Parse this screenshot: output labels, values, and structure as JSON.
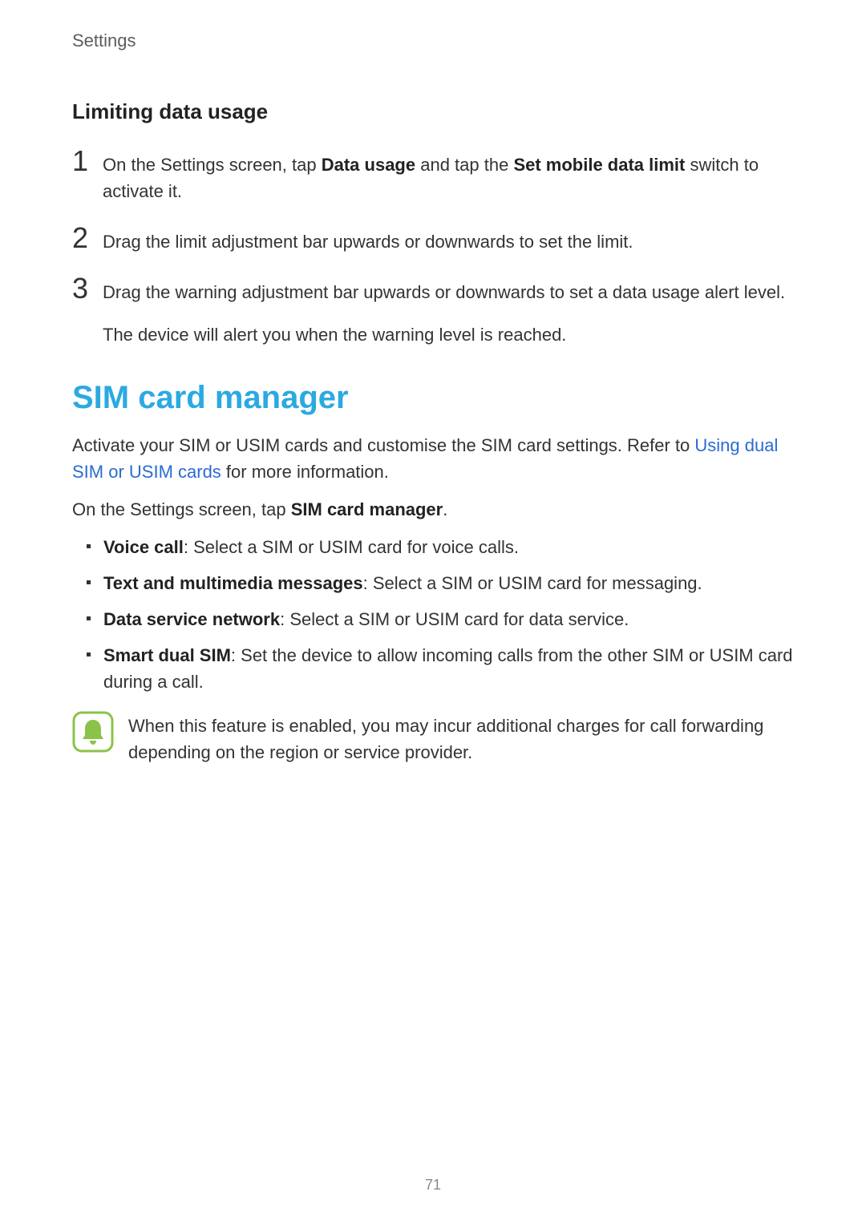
{
  "header": {
    "title": "Settings"
  },
  "subsection": {
    "title": "Limiting data usage"
  },
  "steps": {
    "s1": {
      "num": "1",
      "pre": "On the Settings screen, tap ",
      "bold1": "Data usage",
      "mid": " and tap the ",
      "bold2": "Set mobile data limit",
      "post": " switch to activate it."
    },
    "s2": {
      "num": "2",
      "text": "Drag the limit adjustment bar upwards or downwards to set the limit."
    },
    "s3": {
      "num": "3",
      "line1": "Drag the warning adjustment bar upwards or downwards to set a data usage alert level.",
      "line2": "The device will alert you when the warning level is reached."
    }
  },
  "section": {
    "title": "SIM card manager",
    "intro_pre": "Activate your SIM or USIM cards and customise the SIM card settings. Refer to ",
    "intro_link": "Using dual SIM or USIM cards",
    "intro_post": " for more information.",
    "instruction_pre": "On the Settings screen, tap ",
    "instruction_bold": "SIM card manager",
    "instruction_post": "."
  },
  "bullets": {
    "b1": {
      "bold": "Voice call",
      "text": ": Select a SIM or USIM card for voice calls."
    },
    "b2": {
      "bold": "Text and multimedia messages",
      "text": ": Select a SIM or USIM card for messaging."
    },
    "b3": {
      "bold": "Data service network",
      "text": ": Select a SIM or USIM card for data service."
    },
    "b4": {
      "bold": "Smart dual SIM",
      "text": ": Set the device to allow incoming calls from the other SIM or USIM card during a call."
    }
  },
  "note": {
    "text": "When this feature is enabled, you may incur additional charges for call forwarding depending on the region or service provider."
  },
  "page_number": "71"
}
